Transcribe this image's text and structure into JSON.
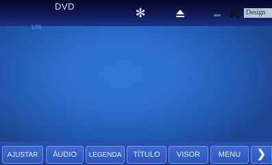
{
  "header": {
    "source_title": "DVD",
    "sub_label": "1/99",
    "brand_text": "Design",
    "icons": {
      "settings": "gear-icon",
      "eject": "eject-icon",
      "minimize": "minimize-icon",
      "close": "close-icon"
    },
    "gear_glyph": "✻"
  },
  "menu": {
    "buttons": [
      {
        "label": "AJUSTAR"
      },
      {
        "label": "ÁUDIO"
      },
      {
        "label": "LEGENDA"
      },
      {
        "label": "TÍTULO"
      },
      {
        "label": "VISOR"
      },
      {
        "label": "MENU"
      }
    ],
    "next_glyph": "❯"
  },
  "colors": {
    "screen_blue": "#2a6cc9",
    "header_dark": "#06082a",
    "button_blue": "#3b6dd4"
  }
}
